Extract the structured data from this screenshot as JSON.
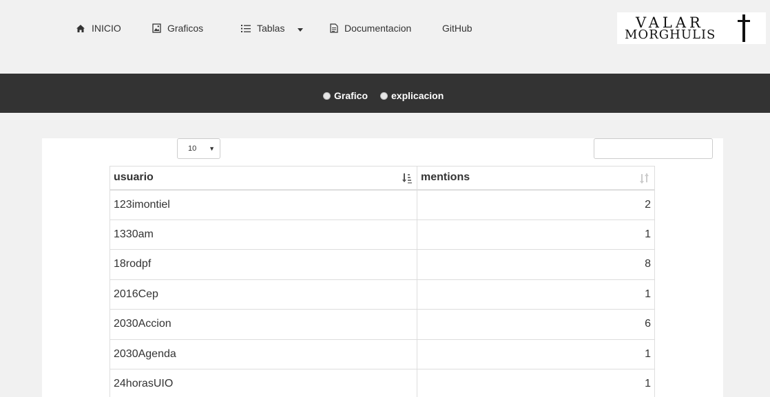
{
  "nav": {
    "items": [
      {
        "label": "INICIO",
        "icon": "home-icon"
      },
      {
        "label": "Graficos",
        "icon": "image-icon"
      },
      {
        "label": "Tablas",
        "icon": "list-icon"
      },
      {
        "label": "Documentacion",
        "icon": "document-icon"
      },
      {
        "label": "GitHub"
      }
    ],
    "logo": {
      "line1": "VALAR",
      "line2": "MORGHULIS"
    }
  },
  "subnav": {
    "options": [
      "Grafico",
      "explicacion"
    ]
  },
  "table_controls": {
    "page_length": "10",
    "search_value": ""
  },
  "table": {
    "columns": [
      "usuario",
      "mentions"
    ],
    "rows": [
      {
        "usuario": "123imontiel",
        "mentions": "2"
      },
      {
        "usuario": "1330am",
        "mentions": "1"
      },
      {
        "usuario": "18rodpf",
        "mentions": "8"
      },
      {
        "usuario": "2016Cep",
        "mentions": "1"
      },
      {
        "usuario": "2030Accion",
        "mentions": "6"
      },
      {
        "usuario": "2030Agenda",
        "mentions": "1"
      },
      {
        "usuario": "24horasUIO",
        "mentions": "1"
      }
    ]
  },
  "colors": {
    "page_bg": "#f1f1f1",
    "dark_bar": "#333333",
    "text": "#333333",
    "border": "#dddddd"
  }
}
